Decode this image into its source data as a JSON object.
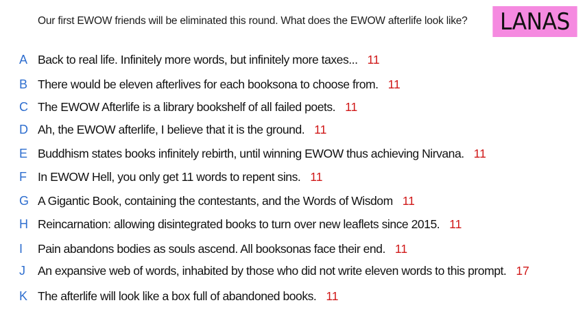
{
  "prompt": "Our first EWOW friends will be eliminated this round. What does the EWOW afterlife look like?",
  "badge": {
    "label": "LANAS",
    "color": "#f58ae0"
  },
  "colors": {
    "letter": "#2e6ecf",
    "score": "#d01818"
  },
  "entries": [
    {
      "letter": "A",
      "text": "Back to real life. Infinitely more words, but infinitely more taxes...",
      "score": "11"
    },
    {
      "letter": "B",
      "text": "There would be eleven afterlives for each booksona to choose from.",
      "score": "11"
    },
    {
      "letter": "C",
      "text": "The EWOW Afterlife is a library bookshelf of all failed poets.",
      "score": "11"
    },
    {
      "letter": "D",
      "text": "Ah, the EWOW afterlife, I believe that it is the ground.",
      "score": "11"
    },
    {
      "letter": "E",
      "text": "Buddhism states books infinitely rebirth, until winning EWOW thus achieving Nirvana.",
      "score": "11"
    },
    {
      "letter": "F",
      "text": "In EWOW Hell, you only get 11 words to repent sins.",
      "score": "11"
    },
    {
      "letter": "G",
      "text": "A Gigantic Book, containing the contestants, and the Words of Wisdom",
      "score": "11"
    },
    {
      "letter": "H",
      "text": "Reincarnation: allowing disintegrated books to turn over new leaflets since 2015.",
      "score": "11"
    },
    {
      "letter": "I",
      "text": "Pain abandons bodies as souls ascend. All booksonas face their end.",
      "score": "11"
    },
    {
      "letter": "J",
      "text": "An expansive web of words, inhabited by those who did not write eleven words to this prompt.",
      "score": "17"
    },
    {
      "letter": "K",
      "text": "The afterlife will look like a box full of abandoned books.",
      "score": "11"
    }
  ]
}
